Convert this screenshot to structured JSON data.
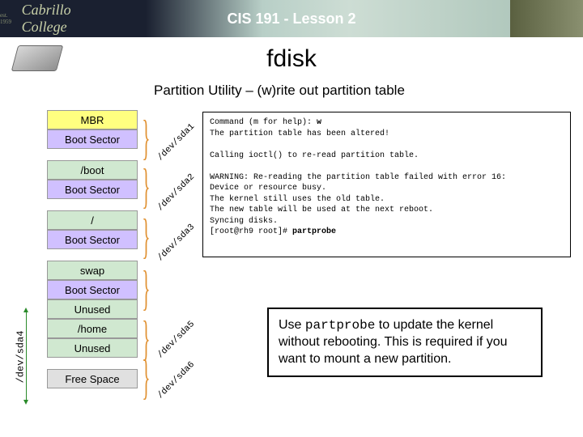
{
  "header": {
    "college": "Cabrillo College",
    "est": "est. 1959",
    "lesson": "CIS 191 - Lesson 2"
  },
  "title": "fdisk",
  "subtitle": "Partition Utility – (w)rite out partition table",
  "stack": {
    "mbr": "MBR",
    "bs": "Boot Sector",
    "boot": "/boot",
    "root": "/",
    "swap": "swap",
    "unused": "Unused",
    "home": "/home",
    "free": "Free Space"
  },
  "labels": {
    "sda1": "/dev/sda1",
    "sda2": "/dev/sda2",
    "sda3": "/dev/sda3",
    "sda4": "/dev/sda4",
    "sda5": "/dev/sda5",
    "sda6": "/dev/sda6"
  },
  "terminal": {
    "l1a": "Command (m for help): ",
    "l1b": "w",
    "l2": "The partition table has been altered!",
    "l3": "Calling ioctl() to re-read partition table.",
    "l4": "WARNING: Re-reading the partition table failed with error 16:",
    "l5": "Device or resource busy.",
    "l6": "The kernel still uses the old table.",
    "l7": "The new table will be used at the next reboot.",
    "l8": "Syncing disks.",
    "l9a": "[root@rh9 root]# ",
    "l9b": "partprobe"
  },
  "note": {
    "p1": "Use ",
    "p2": "partprobe",
    "p3": " to update the kernel without rebooting.  This is required if you want to mount a new partition."
  }
}
